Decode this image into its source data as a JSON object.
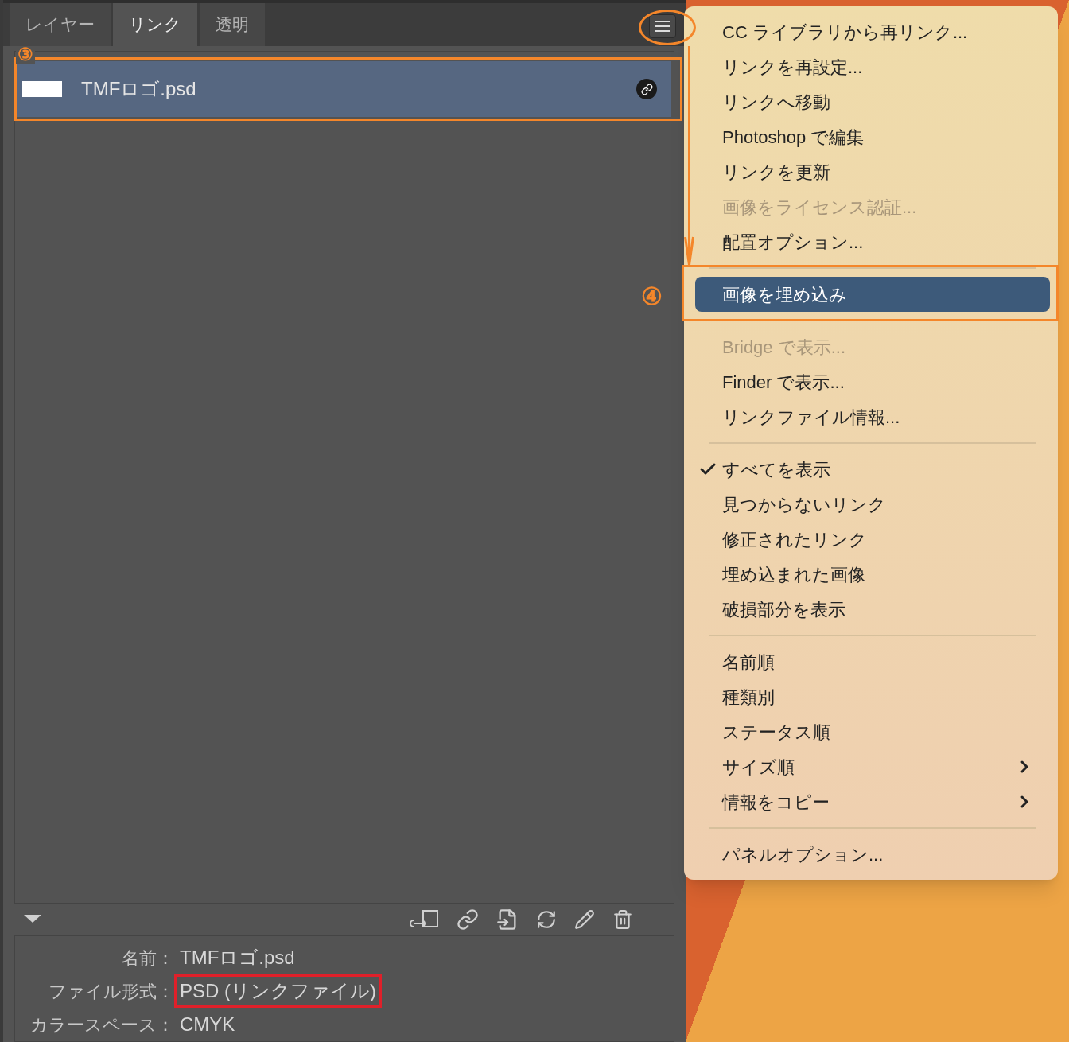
{
  "tabs": [
    {
      "label": "レイヤー",
      "selected": false
    },
    {
      "label": "リンク",
      "selected": true
    },
    {
      "label": "透明",
      "selected": false
    }
  ],
  "links": [
    {
      "name": "TMFロゴ.psd",
      "selected": true
    }
  ],
  "info": [
    {
      "label": "名前：",
      "value": "TMFロゴ.psd",
      "outlined": false
    },
    {
      "label": "ファイル形式：",
      "value": "PSD (リンクファイル)",
      "outlined": true
    },
    {
      "label": "カラースペース：",
      "value": "CMYK",
      "outlined": false
    }
  ],
  "menu": [
    {
      "kind": "item",
      "label": "CC ライブラリから再リンク...",
      "disabled": false,
      "selected": false,
      "checked": false
    },
    {
      "kind": "item",
      "label": "リンクを再設定...",
      "disabled": false,
      "selected": false,
      "checked": false
    },
    {
      "kind": "item",
      "label": "リンクへ移動",
      "disabled": false,
      "selected": false,
      "checked": false
    },
    {
      "kind": "item",
      "label": "Photoshop で編集",
      "disabled": false,
      "selected": false,
      "checked": false
    },
    {
      "kind": "item",
      "label": "リンクを更新",
      "disabled": false,
      "selected": false,
      "checked": false
    },
    {
      "kind": "item",
      "label": "画像をライセンス認証...",
      "disabled": true,
      "selected": false,
      "checked": false
    },
    {
      "kind": "item",
      "label": "配置オプション...",
      "disabled": false,
      "selected": false,
      "checked": false
    },
    {
      "kind": "separator"
    },
    {
      "kind": "item",
      "label": "画像を埋め込み",
      "disabled": false,
      "selected": true,
      "checked": false
    },
    {
      "kind": "separator"
    },
    {
      "kind": "item",
      "label": "Bridge で表示...",
      "disabled": true,
      "selected": false,
      "checked": false
    },
    {
      "kind": "item",
      "label": "Finder で表示...",
      "disabled": false,
      "selected": false,
      "checked": false
    },
    {
      "kind": "item",
      "label": "リンクファイル情報...",
      "disabled": false,
      "selected": false,
      "checked": false
    },
    {
      "kind": "separator"
    },
    {
      "kind": "item",
      "label": "すべてを表示",
      "disabled": false,
      "selected": false,
      "checked": true
    },
    {
      "kind": "item",
      "label": "見つからないリンク",
      "disabled": false,
      "selected": false,
      "checked": false
    },
    {
      "kind": "item",
      "label": "修正されたリンク",
      "disabled": false,
      "selected": false,
      "checked": false
    },
    {
      "kind": "item",
      "label": "埋め込まれた画像",
      "disabled": false,
      "selected": false,
      "checked": false
    },
    {
      "kind": "item",
      "label": "破損部分を表示",
      "disabled": false,
      "selected": false,
      "checked": false
    },
    {
      "kind": "separator"
    },
    {
      "kind": "item",
      "label": "名前順",
      "disabled": false,
      "selected": false,
      "checked": false
    },
    {
      "kind": "item",
      "label": "種類別",
      "disabled": false,
      "selected": false,
      "checked": false
    },
    {
      "kind": "item",
      "label": "ステータス順",
      "disabled": false,
      "selected": false,
      "checked": false
    },
    {
      "kind": "submenu",
      "label": "サイズ順",
      "disabled": false,
      "selected": false,
      "checked": false
    },
    {
      "kind": "submenu",
      "label": "情報をコピー",
      "disabled": false,
      "selected": false,
      "checked": false
    },
    {
      "kind": "separator"
    },
    {
      "kind": "item",
      "label": "パネルオプション...",
      "disabled": false,
      "selected": false,
      "checked": false
    }
  ],
  "annotations": {
    "row_marker": "③",
    "menu_marker": "④"
  }
}
